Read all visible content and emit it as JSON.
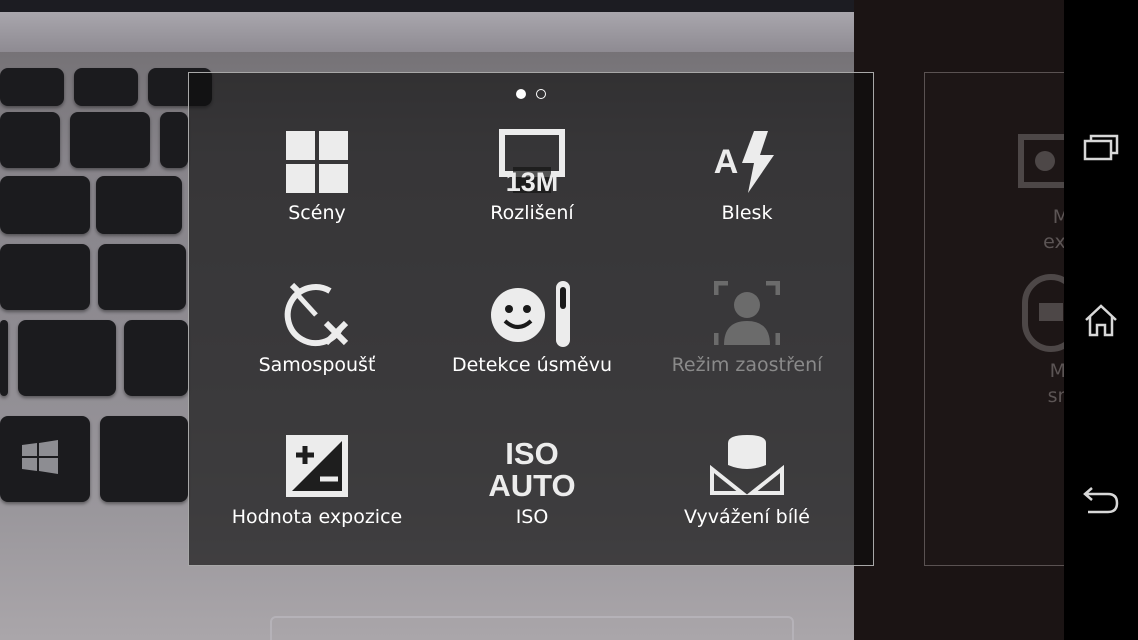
{
  "page_indicator": {
    "current": 1,
    "total": 2
  },
  "settings": [
    {
      "id": "scenes",
      "label": "Scény",
      "icon": "scenes-grid-icon"
    },
    {
      "id": "resolution",
      "label": "Rozlišení",
      "icon": "resolution-13m-icon",
      "icon_text": "13M"
    },
    {
      "id": "flash",
      "label": "Blesk",
      "icon": "flash-auto-icon",
      "icon_text": "A"
    },
    {
      "id": "self_timer",
      "label": "Samospoušť",
      "icon": "self-timer-off-icon"
    },
    {
      "id": "smile_detection",
      "label": "Detekce úsměvu",
      "icon": "smile-detection-icon"
    },
    {
      "id": "focus_mode",
      "label": "Režim zaostření",
      "icon": "focus-mode-icon",
      "disabled": true
    },
    {
      "id": "exposure",
      "label": "Hodnota expozice",
      "icon": "exposure-value-icon"
    },
    {
      "id": "iso",
      "label": "ISO",
      "icon": "iso-auto-icon",
      "icon_text_1": "ISO",
      "icon_text_2": "AUTO"
    },
    {
      "id": "white_balance",
      "label": "Vyvážení bílé",
      "icon": "white-balance-icon"
    }
  ],
  "next_page_preview": [
    {
      "label": "Měření expozice",
      "icon": "metering-icon"
    },
    {
      "label": "Metoda snímání",
      "icon": "capture-method-icon"
    }
  ],
  "nav_bar": [
    "recent-apps-icon",
    "home-icon",
    "back-icon"
  ],
  "colors": {
    "panel_border": "#a8a8a8",
    "disabled_text": "#8a8a8a",
    "nav_bg": "#000000"
  }
}
